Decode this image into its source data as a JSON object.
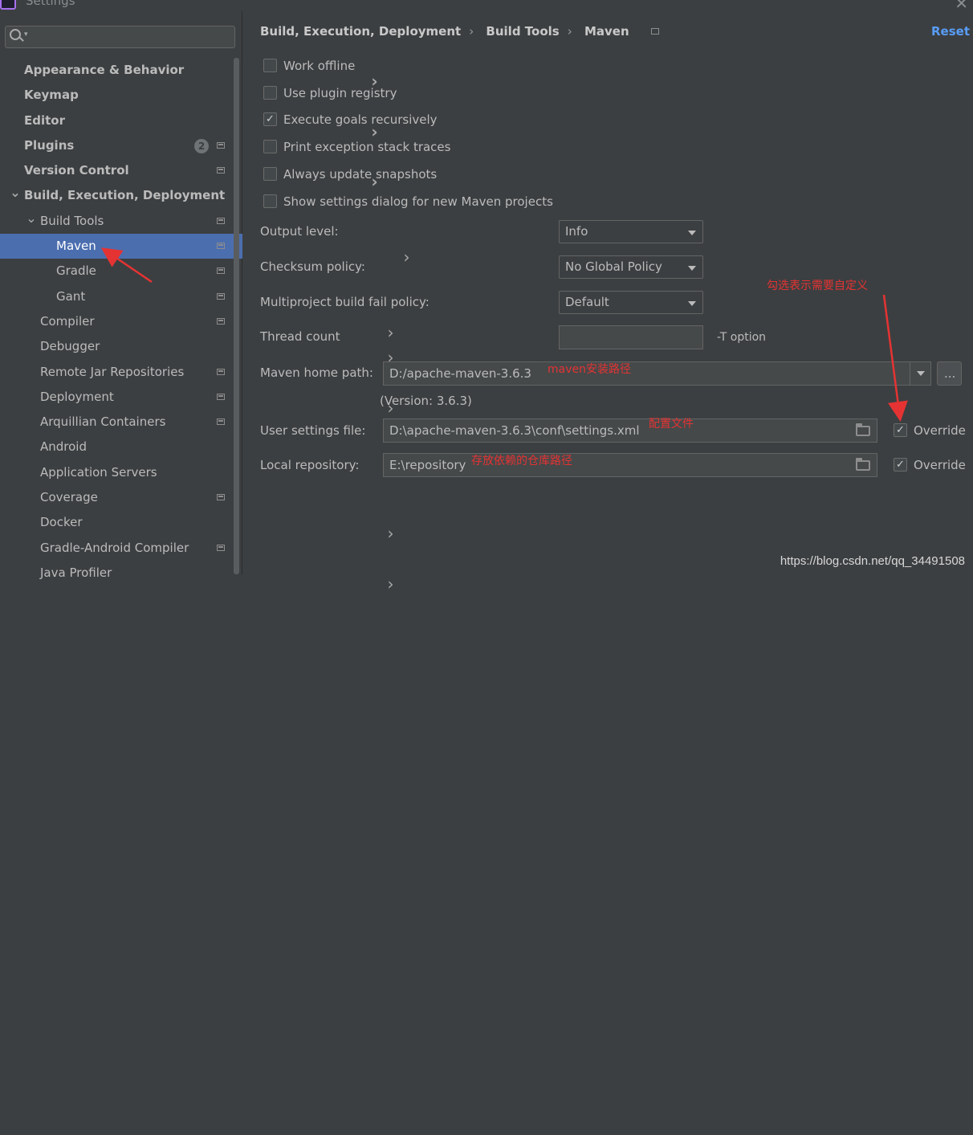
{
  "window": {
    "title": "Settings"
  },
  "search": {
    "placeholder": ""
  },
  "tree": [
    {
      "label": "Appearance & Behavior",
      "bold": true,
      "chevron": "right",
      "level": 0
    },
    {
      "label": "Keymap",
      "bold": true,
      "chevron": "none",
      "level": 0
    },
    {
      "label": "Editor",
      "bold": true,
      "chevron": "right",
      "level": 0
    },
    {
      "label": "Plugins",
      "bold": true,
      "chevron": "none",
      "level": 0,
      "badge": "2",
      "page_icon": true
    },
    {
      "label": "Version Control",
      "bold": true,
      "chevron": "right",
      "level": 0,
      "page_icon": true
    },
    {
      "label": "Build, Execution, Deployment",
      "bold": true,
      "chevron": "down",
      "level": 0
    },
    {
      "label": "Build Tools",
      "bold": false,
      "chevron": "down",
      "level": 1,
      "page_icon": true
    },
    {
      "label": "Maven",
      "bold": false,
      "chevron": "right",
      "level": 2,
      "page_icon": true,
      "selected": true
    },
    {
      "label": "Gradle",
      "bold": false,
      "chevron": "none",
      "level": 2,
      "page_icon": true
    },
    {
      "label": "Gant",
      "bold": false,
      "chevron": "none",
      "level": 2,
      "page_icon": true
    },
    {
      "label": "Compiler",
      "bold": false,
      "chevron": "right",
      "level": 1,
      "page_icon": true
    },
    {
      "label": "Debugger",
      "bold": false,
      "chevron": "right",
      "level": 1
    },
    {
      "label": "Remote Jar Repositories",
      "bold": false,
      "chevron": "none",
      "level": 1,
      "page_icon": true
    },
    {
      "label": "Deployment",
      "bold": false,
      "chevron": "right",
      "level": 1,
      "page_icon": true
    },
    {
      "label": "Arquillian Containers",
      "bold": false,
      "chevron": "none",
      "level": 1,
      "page_icon": true
    },
    {
      "label": "Android",
      "bold": false,
      "chevron": "right",
      "level": 1
    },
    {
      "label": "Application Servers",
      "bold": false,
      "chevron": "none",
      "level": 1
    },
    {
      "label": "Coverage",
      "bold": false,
      "chevron": "none",
      "level": 1,
      "page_icon": true
    },
    {
      "label": "Docker",
      "bold": false,
      "chevron": "right",
      "level": 1
    },
    {
      "label": "Gradle-Android Compiler",
      "bold": false,
      "chevron": "none",
      "level": 1,
      "page_icon": true
    },
    {
      "label": "Java Profiler",
      "bold": false,
      "chevron": "right",
      "level": 1
    }
  ],
  "breadcrumb": [
    "Build, Execution, Deployment",
    "Build Tools",
    "Maven"
  ],
  "reset_label": "Reset",
  "checkboxes": [
    {
      "label": "Work offline",
      "checked": false
    },
    {
      "label": "Use plugin registry",
      "checked": false
    },
    {
      "label": "Execute goals recursively",
      "checked": true
    },
    {
      "label": "Print exception stack traces",
      "checked": false
    },
    {
      "label": "Always update snapshots",
      "checked": false
    },
    {
      "label": "Show settings dialog for new Maven projects",
      "checked": false
    }
  ],
  "output_level": {
    "label": "Output level:",
    "value": "Info"
  },
  "checksum_policy": {
    "label": "Checksum policy:",
    "value": "No Global Policy"
  },
  "fail_policy": {
    "label": "Multiproject build fail policy:",
    "value": "Default"
  },
  "thread_count": {
    "label": "Thread count",
    "value": "",
    "hint": "-T option"
  },
  "maven_home": {
    "label": "Maven home path:",
    "value": "D:/apache-maven-3.6.3",
    "version": "(Version: 3.6.3)",
    "browse_label": "..."
  },
  "user_settings": {
    "label": "User settings file:",
    "value": "D:\\apache-maven-3.6.3\\conf\\settings.xml",
    "override_label": "Override",
    "override_checked": true
  },
  "local_repo": {
    "label": "Local repository:",
    "value": "E:\\repository",
    "override_label": "Override",
    "override_checked": true
  },
  "annotations": {
    "override_note": "勾选表示需要自定义",
    "maven_path_note": "maven安装路径",
    "settings_note": "配置文件",
    "repo_note": "存放依赖的仓库路径"
  },
  "watermark": "https://blog.csdn.net/qq_34491508",
  "colors": {
    "selected": "#4b6eaf",
    "accent": "#589df6",
    "annotation": "#e53333"
  }
}
